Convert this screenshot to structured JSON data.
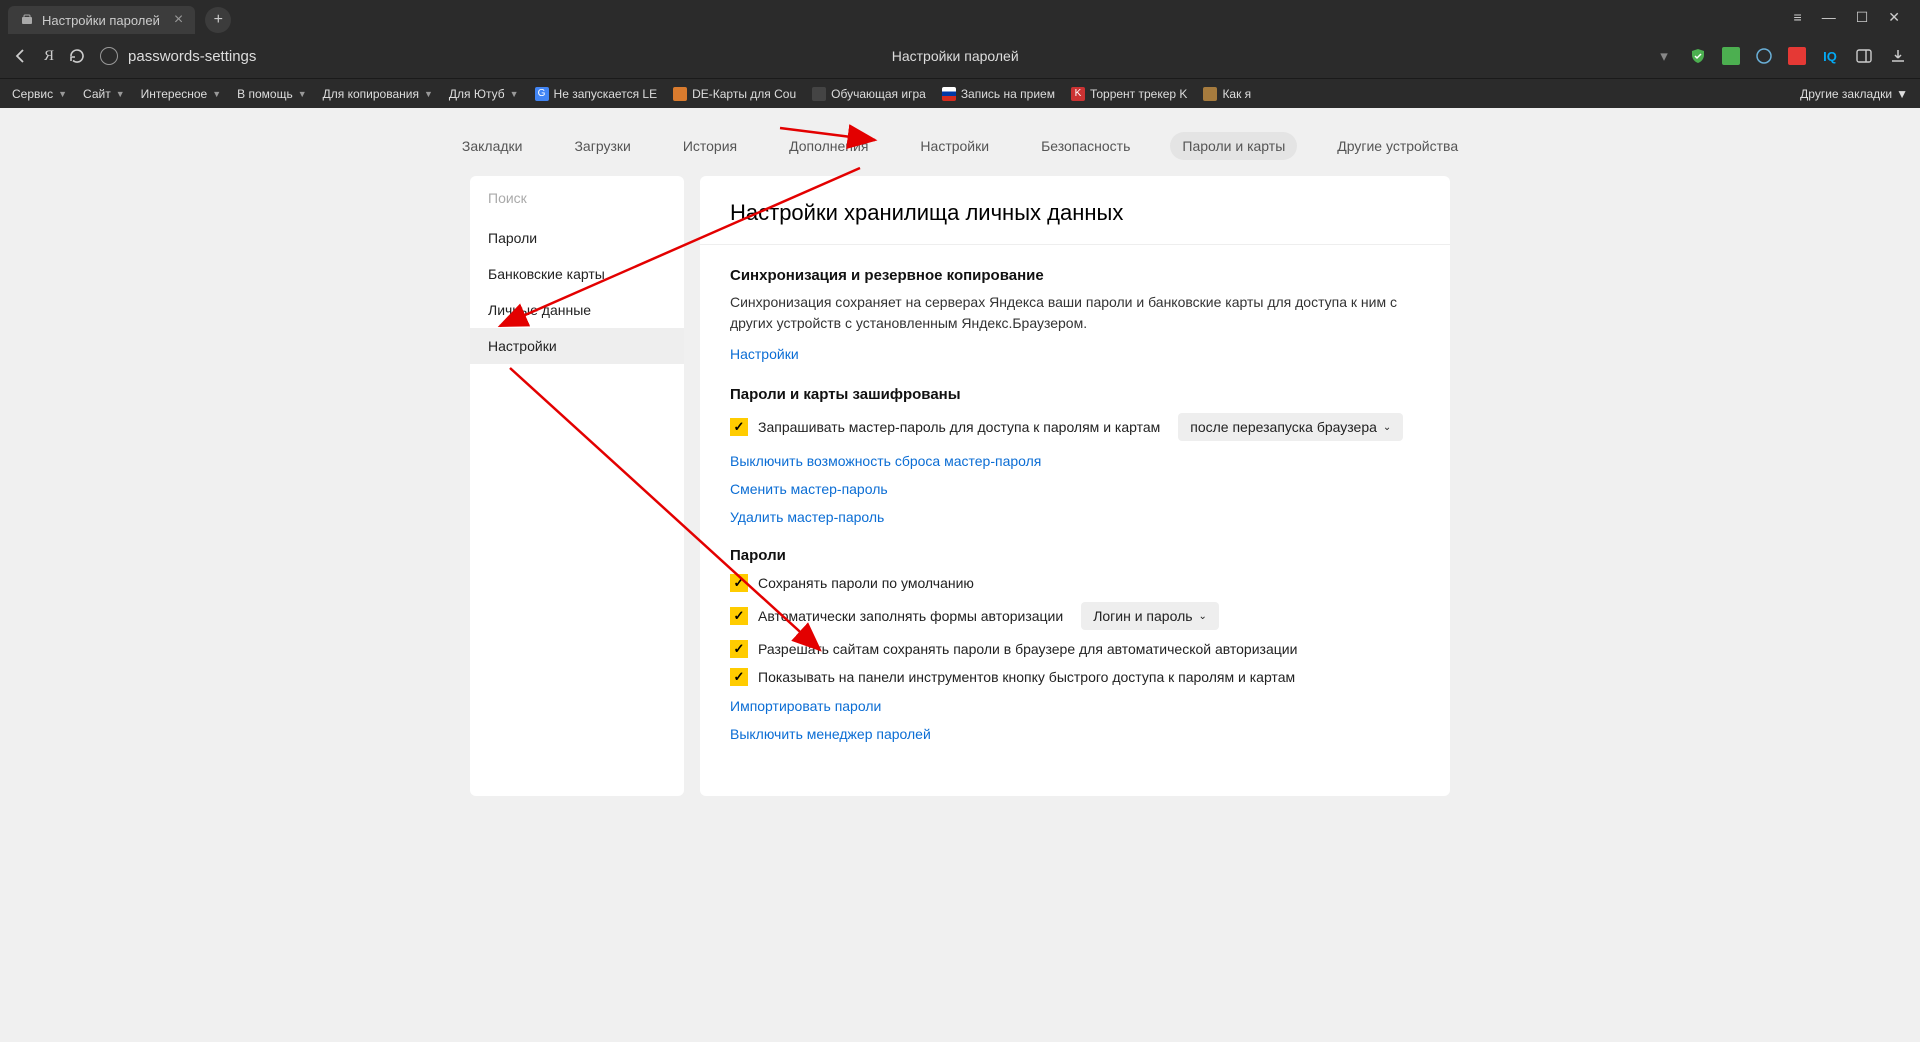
{
  "tab": {
    "title": "Настройки паролей"
  },
  "address": {
    "url": "passwords-settings",
    "page_title": "Настройки паролей"
  },
  "bookmarks_bar": {
    "menus": [
      "Сервис",
      "Сайт",
      "Интересное",
      "В помощь",
      "Для копирования",
      "Для Ютуб"
    ],
    "items": [
      {
        "label": "Не запускается LE",
        "favicon_bg": "#4285f4",
        "favicon_text": "G"
      },
      {
        "label": "DE-Карты для Cou",
        "favicon_bg": "#d97b2e",
        "favicon_text": ""
      },
      {
        "label": "Обучающая игра",
        "favicon_bg": "#444",
        "favicon_text": ""
      },
      {
        "label": "Запись на прием",
        "favicon_bg": "#fff",
        "favicon_text": ""
      },
      {
        "label": "Торрент трекер K",
        "favicon_bg": "#c33",
        "favicon_text": "K"
      },
      {
        "label": "Как я",
        "favicon_bg": "#a67b3e",
        "favicon_text": ""
      }
    ],
    "more": "Другие закладки"
  },
  "top_tabs": [
    "Закладки",
    "Загрузки",
    "История",
    "Дополнения",
    "Настройки",
    "Безопасность",
    "Пароли и карты",
    "Другие устройства"
  ],
  "top_tabs_active_index": 6,
  "sidebar": {
    "search_placeholder": "Поиск",
    "items": [
      "Пароли",
      "Банковские карты",
      "Личные данные",
      "Настройки"
    ],
    "active_index": 3
  },
  "main": {
    "title": "Настройки хранилища личных данных",
    "sync": {
      "heading": "Синхронизация и резервное копирование",
      "desc": "Синхронизация сохраняет на серверах Яндекса ваши пароли и банковские карты для доступа к ним с других устройств с установленным Яндекс.Браузером.",
      "settings_link": "Настройки"
    },
    "encrypted": {
      "heading": "Пароли и карты зашифрованы",
      "ask_master": "Запрашивать мастер-пароль для доступа к паролям и картам",
      "ask_dropdown": "после перезапуска браузера",
      "disable_reset": "Выключить возможность сброса мастер-пароля",
      "change_master": "Сменить мастер-пароль",
      "delete_master": "Удалить мастер-пароль"
    },
    "passwords": {
      "heading": "Пароли",
      "save_default": "Сохранять пароли по умолчанию",
      "autofill": "Автоматически заполнять формы авторизации",
      "autofill_dropdown": "Логин и пароль",
      "allow_sites": "Разрешать сайтам сохранять пароли в браузере для автоматической авторизации",
      "show_button": "Показывать на панели инструментов кнопку быстрого доступа к паролям и картам",
      "import": "Импортировать пароли",
      "disable_manager": "Выключить менеджер паролей"
    }
  }
}
